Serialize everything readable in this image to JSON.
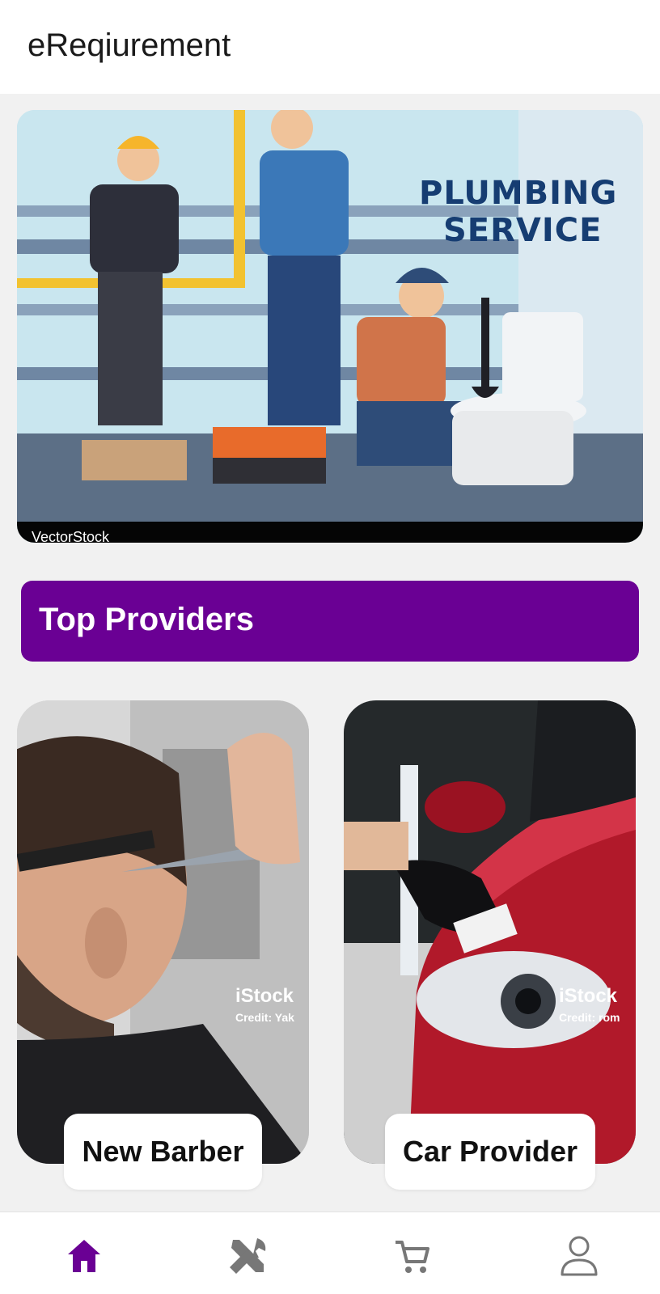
{
  "app": {
    "title": "eReqiurement"
  },
  "banner": {
    "title_line1": "PLUMBING",
    "title_line2": "SERVICE",
    "footer_text": "VectorStock"
  },
  "section": {
    "title": "Top Providers"
  },
  "providers": [
    {
      "name": "New Barber",
      "watermark": "iStock",
      "credit": "Credit: Yak"
    },
    {
      "name": "Car Provider",
      "watermark": "iStock",
      "credit": "Credit: rom"
    }
  ],
  "nav": {
    "items": [
      {
        "icon": "home-icon",
        "active": true
      },
      {
        "icon": "tools-icon",
        "active": false
      },
      {
        "icon": "cart-icon",
        "active": false
      },
      {
        "icon": "profile-icon",
        "active": false
      }
    ]
  },
  "colors": {
    "accent": "#6a0094",
    "inactive_icon": "#777777"
  }
}
